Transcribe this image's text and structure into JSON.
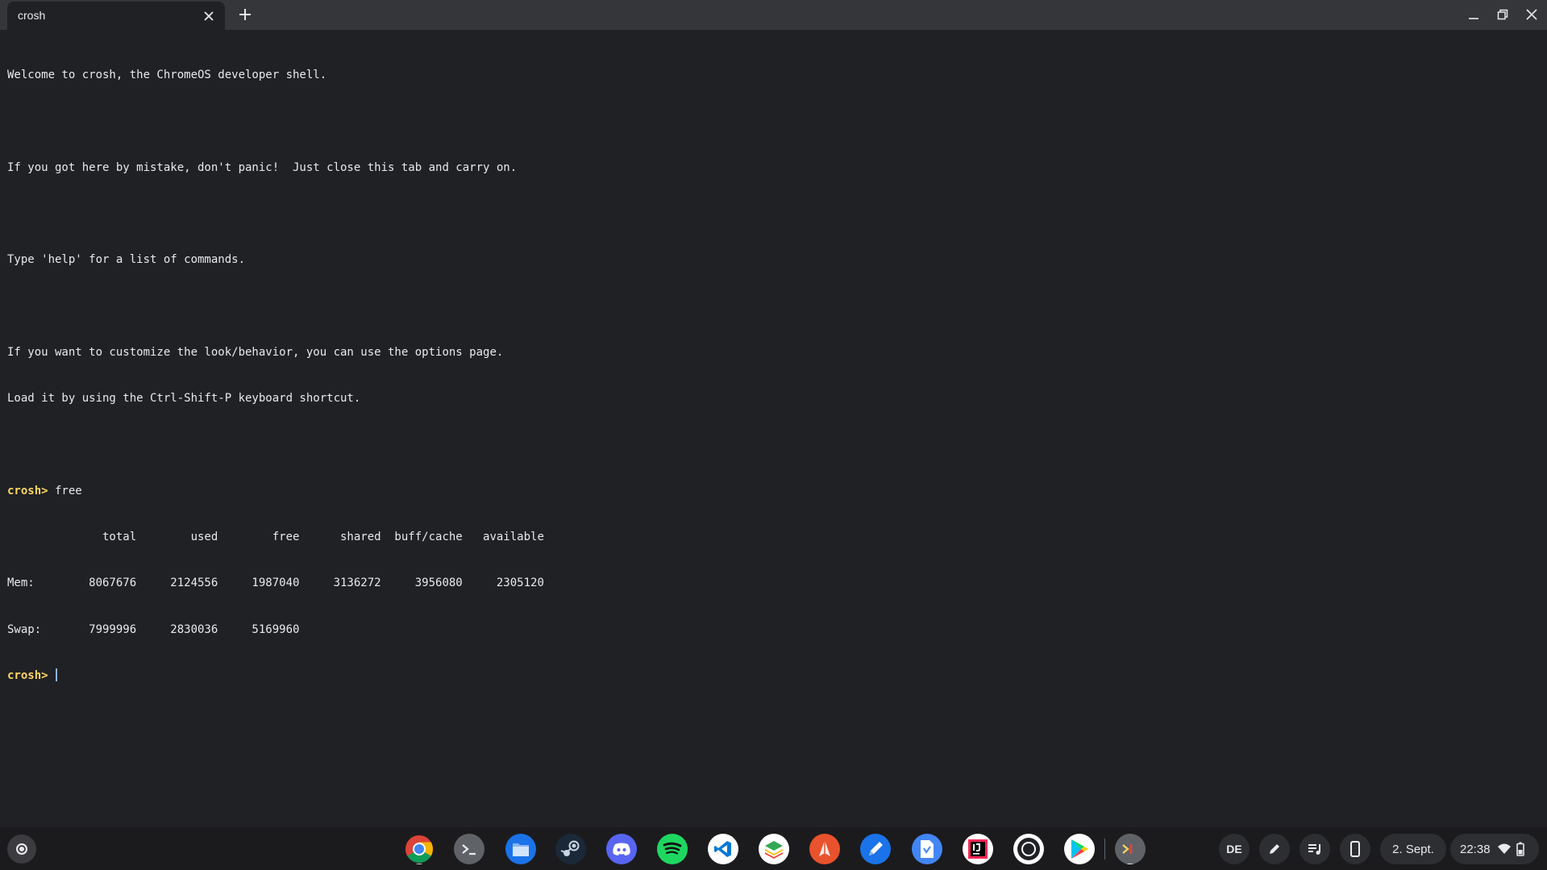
{
  "window": {
    "tab_title": "crosh",
    "tab_close_icon": "close-icon",
    "new_tab_icon": "plus-icon",
    "minimize_icon": "minimize-icon",
    "restore_icon": "restore-icon",
    "close_icon": "close-icon"
  },
  "terminal": {
    "lines": [
      "Welcome to crosh, the ChromeOS developer shell.",
      "",
      "If you got here by mistake, don't panic!  Just close this tab and carry on.",
      "",
      "Type 'help' for a list of commands.",
      "",
      "If you want to customize the look/behavior, you can use the options page.",
      "Load it by using the Ctrl-Shift-P keyboard shortcut.",
      ""
    ],
    "prompt": "crosh>",
    "command": " free",
    "free_header": "              total        used        free      shared  buff/cache   available",
    "free_mem": "Mem:        8067676     2124556     1987040     3136272     3956080     2305120",
    "free_swap": "Swap:       7999996     2830036     5169960",
    "prompt2": "crosh>",
    "input": " "
  },
  "shelf": {
    "launcher_icon": "launcher-icon",
    "apps": [
      {
        "name": "chrome-icon"
      },
      {
        "name": "terminal-icon"
      },
      {
        "name": "files-icon"
      },
      {
        "name": "steam-icon"
      },
      {
        "name": "discord-icon"
      },
      {
        "name": "spotify-icon"
      },
      {
        "name": "vscode-icon"
      },
      {
        "name": "layers-app-icon"
      },
      {
        "name": "pen-app-icon"
      },
      {
        "name": "pencil-app-icon"
      },
      {
        "name": "document-app-icon"
      },
      {
        "name": "intellij-icon"
      },
      {
        "name": "camera-app-icon"
      },
      {
        "name": "play-store-icon"
      },
      {
        "name": "crosh-icon"
      }
    ],
    "tray": {
      "keyboard_layout": "DE",
      "stylus_icon": "stylus-icon",
      "media_icon": "media-queue-icon",
      "phone_icon": "phone-hub-icon",
      "date": "2. Sept.",
      "time": "22:38",
      "wifi_icon": "wifi-icon",
      "battery_icon": "battery-icon"
    }
  },
  "colors": {
    "terminal_bg": "#202124",
    "titlebar_bg": "#35363a",
    "prompt": "#fdd663",
    "cursor": "#8ab4f8",
    "shelf_bg": "#1b1b1e"
  }
}
